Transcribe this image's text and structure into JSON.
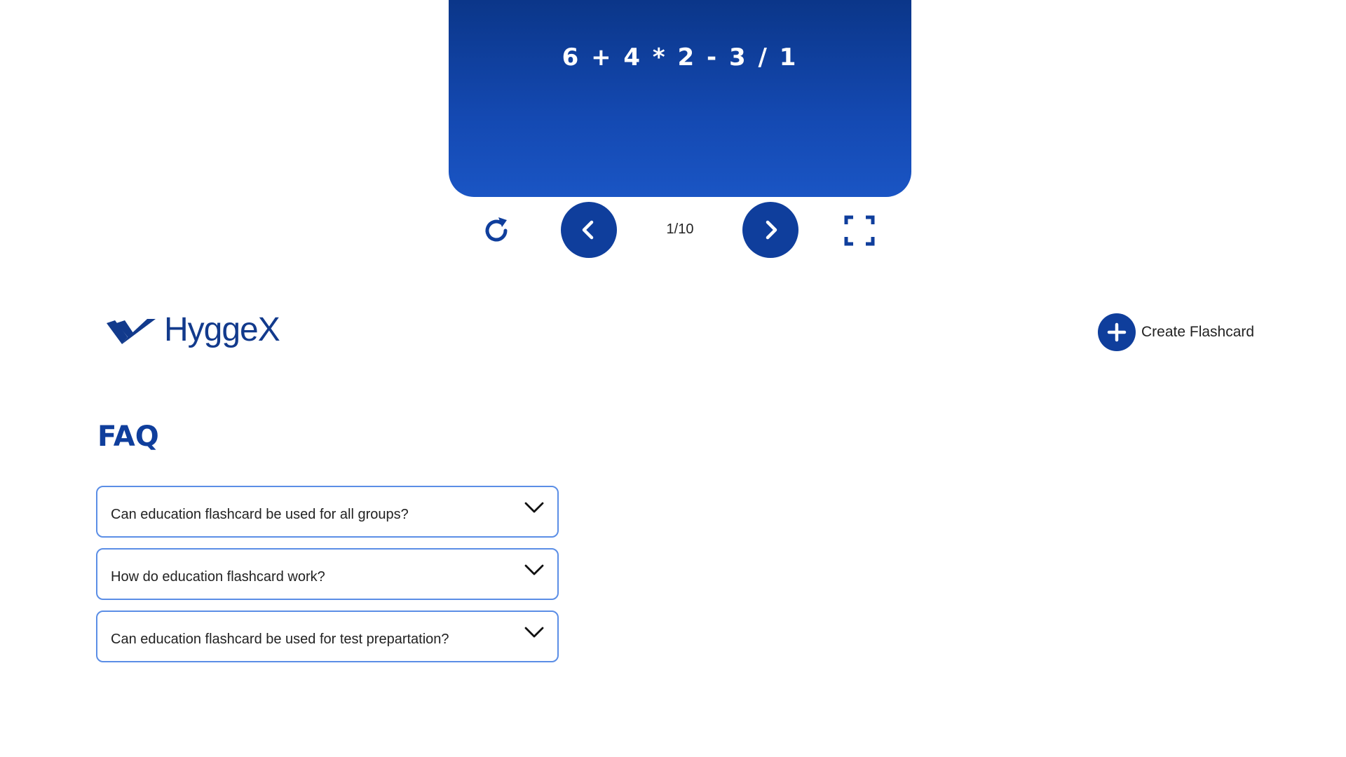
{
  "flashcard": {
    "content": "6 + 4 * 2 - 3 / 1"
  },
  "controls": {
    "counter": "1/10",
    "restart_icon": "restart-icon",
    "prev_icon": "chevron-left-icon",
    "next_icon": "chevron-right-icon",
    "fullscreen_icon": "fullscreen-icon"
  },
  "header": {
    "logo_text": "HyggeX",
    "create_label": "Create Flashcard"
  },
  "faq": {
    "title": "FAQ",
    "items": [
      {
        "question": "Can education flashcard be used for all groups?"
      },
      {
        "question": "How do education flashcard work?"
      },
      {
        "question": "Can education flashcard be used for test prepartation?"
      }
    ]
  },
  "colors": {
    "brand": "#0f3e9c",
    "card_gradient_top": "#0b3689",
    "card_gradient_bottom": "#1a55c4",
    "faq_border": "#5b8ee6"
  }
}
